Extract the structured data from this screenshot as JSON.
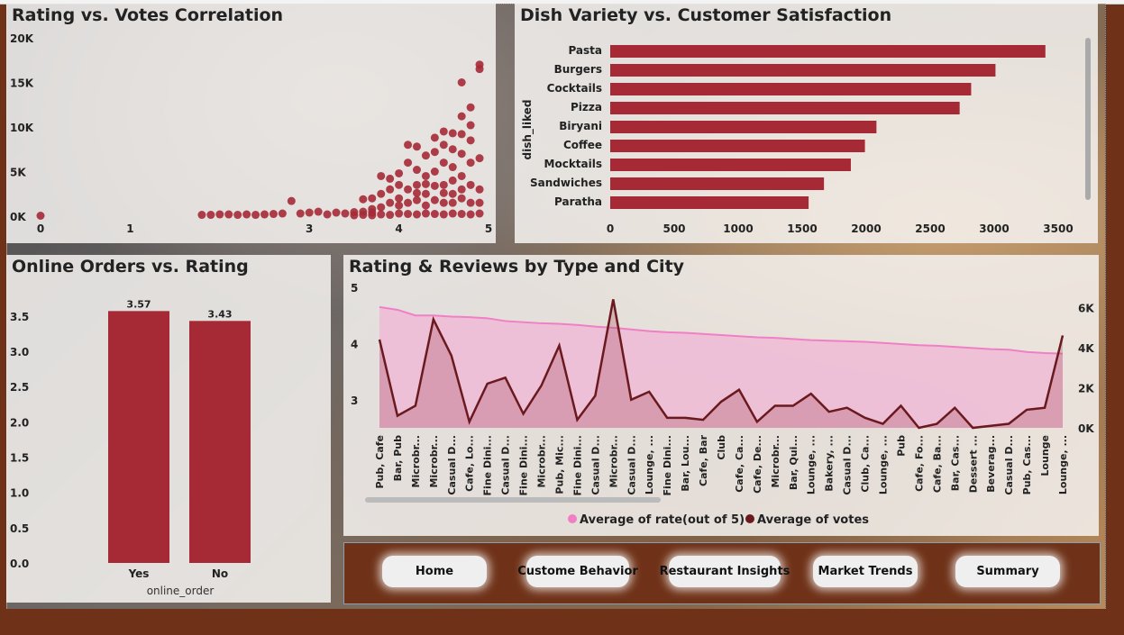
{
  "colors": {
    "bar": "#a52a36",
    "votes_line": "#6a1a1e",
    "rate_area": "#f0b6d6",
    "rate_line": "#f07fc6",
    "nav_bg": "#6f3218"
  },
  "scatter_panel": {
    "title": "Rating vs. Votes Correlation"
  },
  "dish_panel": {
    "title": "Dish Variety vs. Customer Satisfaction"
  },
  "online_panel": {
    "title": "Online Orders vs. Rating"
  },
  "type_city_panel": {
    "title": "Rating & Reviews by Type and City"
  },
  "nav": {
    "buttons": [
      {
        "label": "Home"
      },
      {
        "label": "Custome Behavior"
      },
      {
        "label": "Restaurant Insights"
      },
      {
        "label": "Market Trends"
      },
      {
        "label": "Summary"
      }
    ]
  },
  "chart_data": [
    {
      "type": "scatter",
      "title": "Rating vs. Votes Correlation",
      "xlim": [
        0,
        5
      ],
      "ylim": [
        0,
        20000
      ],
      "xticks": [
        "0",
        "1",
        "3",
        "4",
        "5"
      ],
      "xtick_values": [
        0,
        1,
        3,
        4,
        5
      ],
      "yticks": [
        "0K",
        "5K",
        "10K",
        "15K",
        "20K"
      ],
      "ytick_values": [
        0,
        5000,
        10000,
        15000,
        20000
      ],
      "points": [
        [
          0,
          50
        ],
        [
          1.8,
          150
        ],
        [
          1.9,
          150
        ],
        [
          2.0,
          200
        ],
        [
          2.1,
          200
        ],
        [
          2.2,
          150
        ],
        [
          2.3,
          200
        ],
        [
          2.4,
          150
        ],
        [
          2.5,
          200
        ],
        [
          2.6,
          250
        ],
        [
          2.7,
          300
        ],
        [
          2.8,
          1700
        ],
        [
          2.9,
          300
        ],
        [
          3.0,
          400
        ],
        [
          3.1,
          500
        ],
        [
          3.2,
          200
        ],
        [
          3.3,
          400
        ],
        [
          3.4,
          300
        ],
        [
          3.5,
          450
        ],
        [
          3.6,
          1900
        ],
        [
          3.6,
          500
        ],
        [
          3.7,
          800
        ],
        [
          3.7,
          400
        ],
        [
          3.7,
          2000
        ],
        [
          3.8,
          1000
        ],
        [
          3.8,
          4500
        ],
        [
          3.9,
          1500
        ],
        [
          3.9,
          4200
        ],
        [
          4.0,
          2000
        ],
        [
          4.0,
          4800
        ],
        [
          4.1,
          3000
        ],
        [
          4.1,
          8000
        ],
        [
          4.1,
          6000
        ],
        [
          4.2,
          5200
        ],
        [
          4.2,
          7800
        ],
        [
          4.2,
          3500
        ],
        [
          4.3,
          6800
        ],
        [
          4.3,
          4500
        ],
        [
          4.3,
          2500
        ],
        [
          4.4,
          7200
        ],
        [
          4.4,
          8800
        ],
        [
          4.4,
          5000
        ],
        [
          4.5,
          9500
        ],
        [
          4.5,
          8000
        ],
        [
          4.5,
          6000
        ],
        [
          4.5,
          3500
        ],
        [
          4.6,
          7500
        ],
        [
          4.6,
          5500
        ],
        [
          4.6,
          2500
        ],
        [
          4.6,
          9300
        ],
        [
          4.7,
          15000
        ],
        [
          4.7,
          11200
        ],
        [
          4.7,
          9200
        ],
        [
          4.7,
          7000
        ],
        [
          4.7,
          4500
        ],
        [
          4.8,
          12200
        ],
        [
          4.8,
          10200
        ],
        [
          4.8,
          8500
        ],
        [
          4.8,
          6000
        ],
        [
          4.9,
          16500
        ],
        [
          4.9,
          17000
        ],
        [
          4.9,
          6500
        ],
        [
          4.9,
          3000
        ],
        [
          3.5,
          100
        ],
        [
          3.6,
          150
        ],
        [
          3.7,
          100
        ],
        [
          3.8,
          200
        ],
        [
          3.9,
          150
        ],
        [
          4.0,
          300
        ],
        [
          4.1,
          250
        ],
        [
          4.2,
          200
        ],
        [
          4.3,
          300
        ],
        [
          4.4,
          250
        ],
        [
          4.5,
          200
        ],
        [
          4.6,
          300
        ],
        [
          4.7,
          250
        ],
        [
          4.8,
          200
        ],
        [
          4.9,
          300
        ],
        [
          3.8,
          2500
        ],
        [
          3.9,
          3000
        ],
        [
          4.0,
          3500
        ],
        [
          4.0,
          1200
        ],
        [
          4.1,
          1500
        ],
        [
          4.2,
          1800
        ],
        [
          4.3,
          1200
        ],
        [
          4.4,
          1800
        ],
        [
          4.5,
          1500
        ],
        [
          4.6,
          1500
        ],
        [
          4.7,
          2000
        ],
        [
          4.8,
          1500
        ],
        [
          4.9,
          1500
        ],
        [
          4.2,
          2600
        ],
        [
          4.3,
          3600
        ],
        [
          4.4,
          3400
        ],
        [
          4.5,
          2600
        ],
        [
          4.6,
          4000
        ],
        [
          4.7,
          3000
        ],
        [
          4.8,
          3500
        ]
      ]
    },
    {
      "type": "bar",
      "orientation": "horizontal",
      "title": "Dish Variety vs. Customer Satisfaction",
      "ylabel": "dish_liked",
      "categories": [
        "Pasta",
        "Burgers",
        "Cocktails",
        "Pizza",
        "Biryani",
        "Coffee",
        "Mocktails",
        "Sandwiches",
        "Paratha"
      ],
      "values": [
        3400,
        3010,
        2820,
        2730,
        2080,
        1990,
        1880,
        1670,
        1550
      ],
      "xlim": [
        0,
        3500
      ],
      "xticks": [
        "0",
        "500",
        "1000",
        "1500",
        "2000",
        "2500",
        "3000",
        "3500"
      ],
      "xtick_values": [
        0,
        500,
        1000,
        1500,
        2000,
        2500,
        3000,
        3500
      ]
    },
    {
      "type": "bar",
      "title": "Online Orders vs. Rating",
      "xlabel": "online_order",
      "categories": [
        "Yes",
        "No"
      ],
      "values": [
        3.57,
        3.43
      ],
      "data_labels": [
        "3.57",
        "3.43"
      ],
      "ylim": [
        0,
        3.6
      ],
      "yticks": [
        "0.0",
        "0.5",
        "1.0",
        "1.5",
        "2.0",
        "2.5",
        "3.0",
        "3.5"
      ],
      "ytick_values": [
        0,
        0.5,
        1,
        1.5,
        2,
        2.5,
        3,
        3.5
      ]
    },
    {
      "type": "line",
      "title": "Rating & Reviews by Type and City",
      "categories": [
        "Pub, Cafe",
        "Bar, Pub",
        "Microbr...",
        "Microbr...",
        "Casual D...",
        "Cafe, Lo...",
        "Fine Dini...",
        "Casual D...",
        "Fine Dini...",
        "Microbr...",
        "Pub, Mic...",
        "Fine Dini...",
        "Casual D...",
        "Microbr...",
        "Casual D...",
        "Lounge, ...",
        "Fine Dini...",
        "Bar, Lou...",
        "Cafe, Bar",
        "Club",
        "Cafe, Ca...",
        "Cafe, De...",
        "Microbr...",
        "Bar, Qui...",
        "Lounge, ...",
        "Bakery, ...",
        "Casual D...",
        "Club, Ca...",
        "Lounge, ...",
        "Pub",
        "Cafe, Fo...",
        "Cafe, Ba...",
        "Bar, Cas...",
        "Dessert ...",
        "Beverag...",
        "Casual D...",
        "Pub, Cas...",
        "Lounge",
        "Lounge, ..."
      ],
      "series": [
        {
          "name": "Average of rate(out of 5)",
          "axis": "left",
          "ylim": [
            2.5,
            5
          ],
          "yticks": [
            "3",
            "4",
            "5"
          ],
          "ytick_values": [
            3,
            4,
            5
          ],
          "values": [
            4.65,
            4.6,
            4.5,
            4.5,
            4.48,
            4.47,
            4.45,
            4.4,
            4.38,
            4.36,
            4.35,
            4.33,
            4.3,
            4.28,
            4.25,
            4.22,
            4.2,
            4.19,
            4.17,
            4.15,
            4.13,
            4.11,
            4.1,
            4.08,
            4.06,
            4.05,
            4.04,
            4.03,
            4.01,
            3.99,
            3.97,
            3.96,
            3.94,
            3.92,
            3.9,
            3.89,
            3.85,
            3.83,
            3.82
          ]
        },
        {
          "name": "Average of votes",
          "axis": "right",
          "ylim": [
            0,
            7000
          ],
          "yticks": [
            "0K",
            "2K",
            "4K",
            "6K"
          ],
          "ytick_values": [
            0,
            2000,
            4000,
            6000
          ],
          "values": [
            4400,
            600,
            1100,
            5400,
            3600,
            300,
            2200,
            2500,
            700,
            2100,
            4100,
            400,
            1600,
            6400,
            1400,
            1800,
            500,
            500,
            400,
            1300,
            1900,
            300,
            1100,
            1100,
            1700,
            800,
            1000,
            500,
            200,
            1100,
            0,
            200,
            1000,
            0,
            100,
            200,
            900,
            1000,
            4600
          ]
        }
      ],
      "legend": "bottom"
    }
  ]
}
